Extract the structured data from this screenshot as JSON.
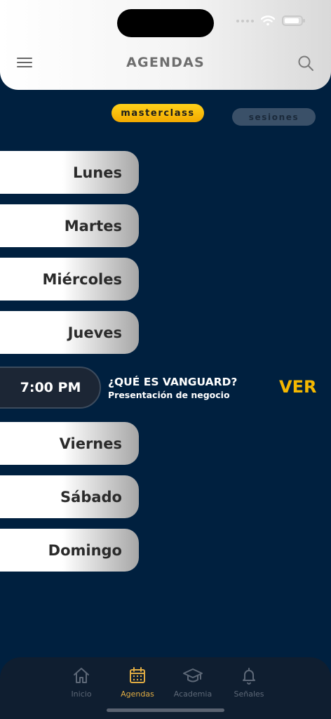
{
  "header": {
    "title": "AGENDAS"
  },
  "filters": {
    "masterclass": "masterclass",
    "sesiones": "sesiones"
  },
  "days": [
    "Lunes",
    "Martes",
    "Miércoles",
    "Jueves",
    "Viernes",
    "Sábado",
    "Domingo"
  ],
  "event": {
    "time": "7:00 PM",
    "title": "¿QUÉ ES VANGUARD?",
    "subtitle": "Presentación de negocio",
    "action": "VER"
  },
  "tabs": [
    {
      "label": "Inicio",
      "icon": "home-icon",
      "active": false
    },
    {
      "label": "Agendas",
      "icon": "calendar-icon",
      "active": true
    },
    {
      "label": "Academia",
      "icon": "graduation-cap-icon",
      "active": false
    },
    {
      "label": "Señales",
      "icon": "bell-icon",
      "active": false
    }
  ],
  "colors": {
    "background": "#00203f",
    "accent": "#f5b800",
    "tab_active": "#e0ac43"
  }
}
